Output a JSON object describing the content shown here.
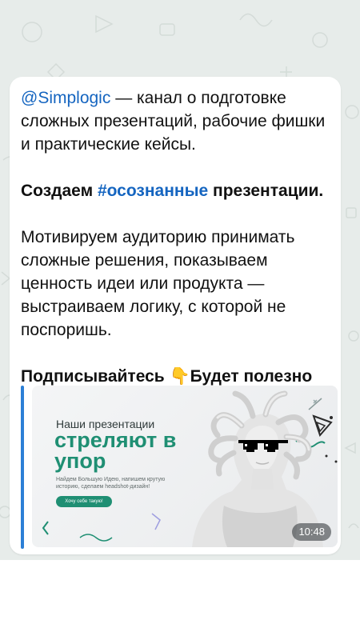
{
  "message": {
    "mention": "@Simplogic",
    "intro_rest": " — канал о подготовке сложных презентаций, рабочие фишки и практические кейсы.",
    "line2_start": "Создаем ",
    "line2_hashtag": "#осознанные",
    "line2_end": " презентации.",
    "paragraph3": "Мотивируем аудиторию принимать сложные решения, показываем ценность идеи или продукта — выстраиваем логику, с которой не поспоришь.",
    "cta_text": "Подписывайтесь ",
    "cta_emoji": "👇",
    "cta_end": "Будет полезно"
  },
  "preview": {
    "small_title": "Наши презентации",
    "big_title": "стреляют в упор",
    "description": "Найдем Большую Идею, напишем крутую историю, сделаем headshot-дизайн!",
    "button_label": "Хочу себе такую!",
    "time": "10:48",
    "icon": "sunglasses-icon"
  },
  "colors": {
    "link": "#1565c0",
    "accent_green": "#1f8f73",
    "preview_bar": "#2c7fd6",
    "chat_bg": "#e7ecea"
  }
}
